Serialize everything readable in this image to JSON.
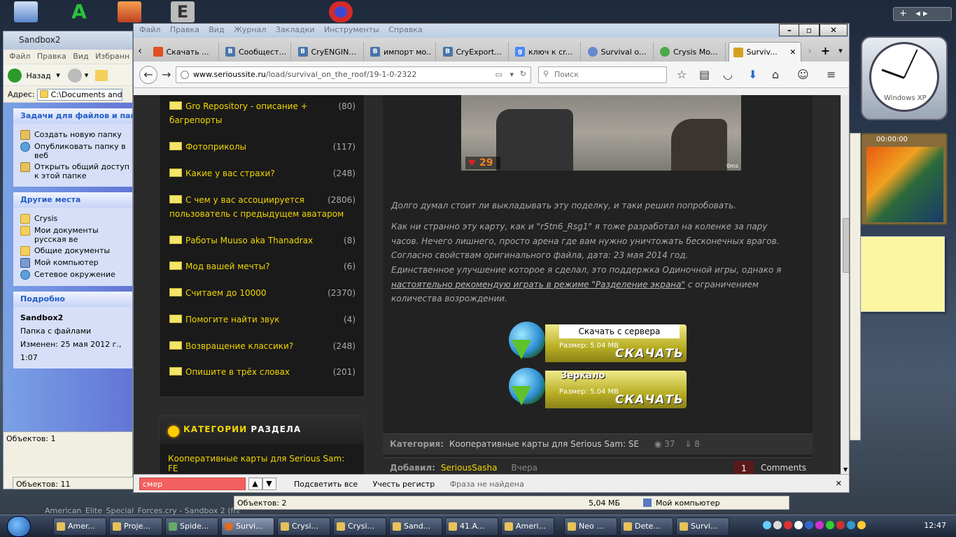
{
  "explorer": {
    "title": "Sandbox2",
    "menu": [
      "Файл",
      "Правка",
      "Вид",
      "Избранн"
    ],
    "toolbar": {
      "back_label": "Назад"
    },
    "address_label": "Адрес:",
    "address_value": "C:\\Documents and Sett",
    "tasks_header": "Задачи для файлов и папок",
    "tasks": [
      "Создать новую папку",
      "Опубликовать папку в веб",
      "Открыть общий доступ к этой папке"
    ],
    "places_header": "Другие места",
    "places": [
      "Crysis",
      "Мои документы русская ве",
      "Общие документы",
      "Мой компьютер",
      "Сетевое окружение"
    ],
    "details_header": "Подробно",
    "details_name": "Sandbox2",
    "details_type": "Папка с файлами",
    "details_modified": "Изменен: 25 мая 2012 г., 1:07",
    "status": "Объектов: 1"
  },
  "explorer2": {
    "status_left": "Объектов: 11",
    "window_title": "American_Elite_Special_Forces.cry - Sandbox 2 (fra...",
    "status2": "Объектов: 2",
    "size": "5,04 МБ",
    "location": "Мой компьютер",
    "partial_label": "Comm",
    "partial_s": "S"
  },
  "firefox": {
    "menu": [
      "Файл",
      "Правка",
      "Вид",
      "Журнал",
      "Закладки",
      "Инструменты",
      "Справка"
    ],
    "tabs": [
      {
        "label": "Скачать ...",
        "fav": "",
        "color": "#e05020"
      },
      {
        "label": "Сообщест...",
        "fav": "B",
        "color": "#4a76a8"
      },
      {
        "label": "CryENGIN...",
        "fav": "B",
        "color": "#4a76a8"
      },
      {
        "label": "импорт мо...",
        "fav": "B",
        "color": "#4a76a8"
      },
      {
        "label": "CryExport...",
        "fav": "B",
        "color": "#4a76a8"
      },
      {
        "label": "ключ к cr...",
        "fav": "g",
        "color": "#4a8af4"
      },
      {
        "label": "Survival o...",
        "fav": "",
        "color": "#6688cc"
      },
      {
        "label": "Crysis Mo...",
        "fav": "",
        "color": "#4aaa4a"
      },
      {
        "label": "Surviv...",
        "fav": "",
        "color": "#d4a020"
      }
    ],
    "url_host": "www.serioussite.ru",
    "url_path": "/load/survival_on_the_roof/19-1-0-2322",
    "search_placeholder": "Поиск"
  },
  "sidebar": {
    "forums": [
      {
        "title": "Gro Repository - описание + багрепорты",
        "count": "(80)"
      },
      {
        "title": "Фотоприколы",
        "count": "(117)"
      },
      {
        "title": "Какие у вас страхи?",
        "count": "(248)"
      },
      {
        "title": "С чем у вас ассоциируется пользователь с предыдущем аватаром",
        "count": "(2806)"
      },
      {
        "title": "Работы Muuso aka Thanadrax",
        "count": "(8)"
      },
      {
        "title": "Мод вашей мечты?",
        "count": "(6)"
      },
      {
        "title": "Считаем до 10000",
        "count": "(2370)"
      },
      {
        "title": "Помогите найти звук",
        "count": "(4)"
      },
      {
        "title": "Возвращение классики?",
        "count": "(248)"
      },
      {
        "title": "Опишите в трёх словах",
        "count": "(201)"
      }
    ],
    "categories_title_1": "КАТЕГОРИИ",
    "categories_title_2": "РАЗДЕЛА",
    "category_link": "Кооперативные карты для Serious Sam: FE"
  },
  "content": {
    "hud_health": "29",
    "hud_ms": "0ms",
    "para1": "Долго думал стоит ли выкладывать эту поделку, и таки решил попробовать.",
    "para2": "Как ни странно эту карту, как и \"r5tn6_Rsg1\" я тоже разработал на коленке за пару часов. Нечего лишнего, просто арена где вам нужно уничтожать бесконечных врагов. Согласно свойствам оригинального файла, дата: 23 мая 2014 год.",
    "para3a": "Единственное улучшение которое я сделал, это поддержка Одиночной игры, однако я ",
    "para3link": "настоятельно рекомендую играть в режиме \"Разделение экрана\"",
    "para3b": " с ограничением количества возрождении.",
    "dl1_label": "Скачать с сервера",
    "dl1_size": "Размер: 5.04 MB",
    "dl2_label": "Зеркало",
    "dl2_size": "Размер: 5.04 MB",
    "dl_button": "СКАЧАТЬ",
    "category_key": "Категория:",
    "category_value": "Кооперативные карты для Serious Sam: SE",
    "views": "37",
    "downloads": "8",
    "added_key": "Добавил:",
    "added_user": "SeriousSasha",
    "added_when": "Вчера",
    "comments_count": "1",
    "comments_label": "Comments"
  },
  "findbar": {
    "query": "смер",
    "highlight_all": "Подсветить все",
    "match_case": "Учесть регистр",
    "status": "Фраза не найдена"
  },
  "widgets": {
    "clock_label": "Windows XP",
    "puzzle_timer": "00:00:00"
  },
  "taskbar": {
    "buttons": [
      "Amer...",
      "Proje...",
      "Spide...",
      "Survi...",
      "Crysi...",
      "Crysi...",
      "Sand...",
      "41.A...",
      "Ameri...",
      "Neo ...",
      "Dete...",
      "Survi..."
    ],
    "time": "12:47"
  }
}
